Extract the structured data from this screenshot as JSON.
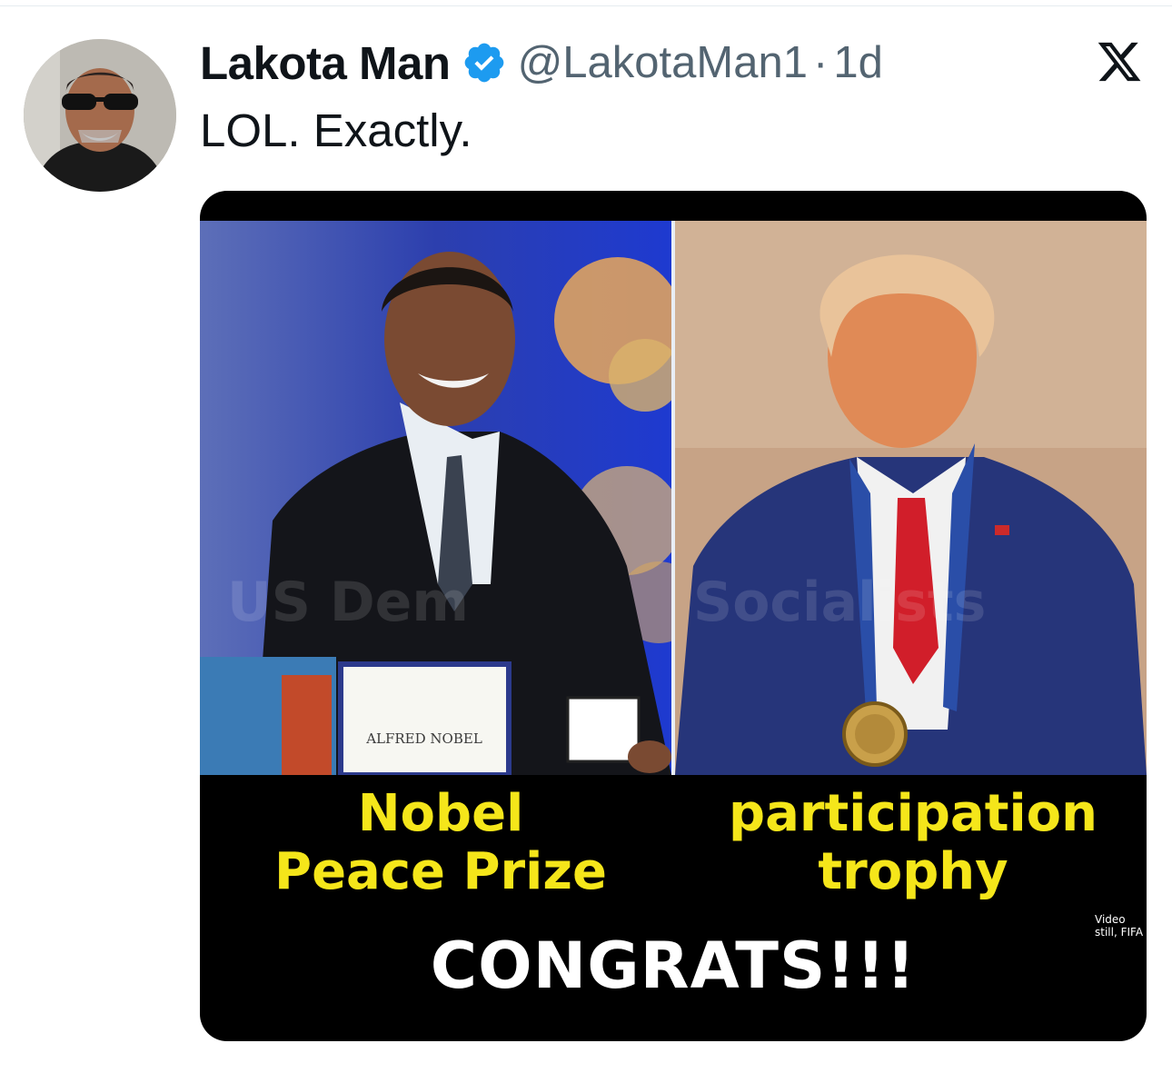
{
  "tweet": {
    "author_name": "Lakota Man",
    "handle": "@LakotaMan1",
    "separator": "·",
    "time": "1d",
    "text": "LOL. Exactly."
  },
  "icons": {
    "verified": "verified-badge-icon",
    "platform": "x-logo-icon"
  },
  "colors": {
    "verified": "#1d9bf0",
    "caption_yellow": "#f5e61a"
  },
  "media": {
    "left_caption_line1": "Nobel",
    "left_caption_line2": "Peace Prize",
    "right_caption_line1": "participation",
    "right_caption_line2": "trophy",
    "bottom_caption": "CONGRATS!!!",
    "diploma_text": "ALFRED NOBEL",
    "photo_credit": "Video still, FIFA",
    "watermark": "US Democratic Socialists"
  }
}
